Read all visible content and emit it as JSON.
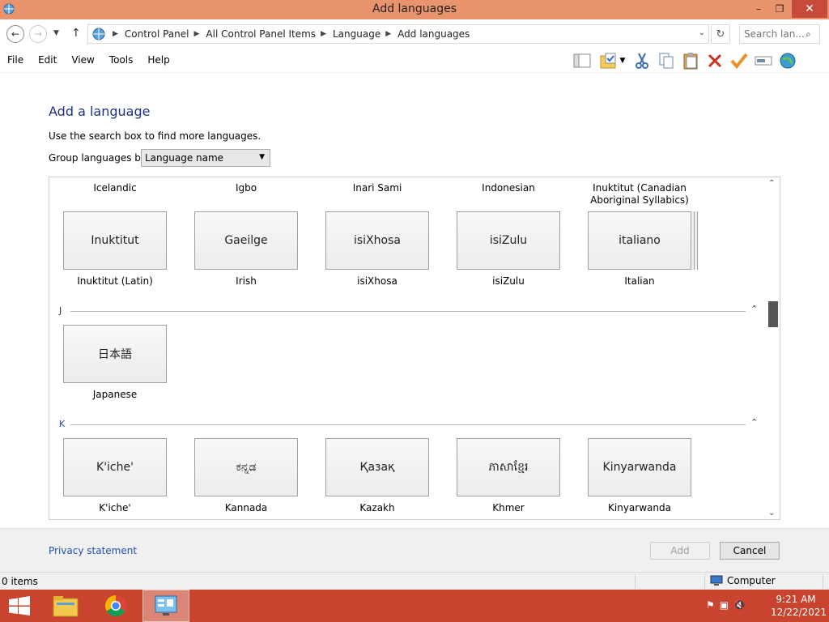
{
  "window": {
    "title": "Add languages",
    "minimize": "–",
    "maximize": "❐",
    "close": "✕"
  },
  "address": {
    "crumbs": [
      "Control Panel",
      "All Control Panel Items",
      "Language",
      "Add languages"
    ],
    "search_placeholder": "Search lan..."
  },
  "menu": [
    "File",
    "Edit",
    "View",
    "Tools",
    "Help"
  ],
  "toolbar_icons": [
    "layout-pane-icon",
    "folder-properties-icon",
    "cut-icon",
    "copy-icon",
    "paste-icon",
    "delete-icon",
    "check-icon",
    "rename-icon",
    "globe-icon"
  ],
  "page": {
    "heading": "Add a language",
    "help_text": "Use the search box to find more languages.",
    "group_label": "Group languages by:",
    "group_value": "Language name"
  },
  "top_labels": [
    "Icelandic",
    "Igbo",
    "Inari Sami",
    "Indonesian",
    "Inuktitut (Canadian Aboriginal Syllabics)"
  ],
  "i_tiles": [
    {
      "native": "Inuktitut",
      "name": "Inuktitut (Latin)"
    },
    {
      "native": "Gaeilge",
      "name": "Irish"
    },
    {
      "native": "isiXhosa",
      "name": "isiXhosa"
    },
    {
      "native": "isiZulu",
      "name": "isiZulu"
    },
    {
      "native": "italiano",
      "name": "Italian"
    }
  ],
  "groups": {
    "j": "J",
    "k": "K",
    "collapse": "⌃"
  },
  "j_tiles": [
    {
      "native": "日本語",
      "name": "Japanese"
    }
  ],
  "k_tiles": [
    {
      "native": "K'iche'",
      "name": "K'iche'"
    },
    {
      "native": "ಕನ್ನಡ",
      "name": "Kannada"
    },
    {
      "native": "Қазақ",
      "name": "Kazakh"
    },
    {
      "native": "ភាសាខ្មែរ",
      "name": "Khmer"
    },
    {
      "native": "Kinyarwanda",
      "name": "Kinyarwanda"
    }
  ],
  "footer": {
    "privacy": "Privacy statement",
    "add": "Add",
    "cancel": "Cancel"
  },
  "status": {
    "items": "0 items",
    "location": "Computer"
  },
  "taskbar": {
    "time": "9:21 AM",
    "date": "12/22/2021"
  },
  "colors": {
    "taskbar": "#c8442e",
    "titlebar": "#e9946c",
    "heading": "#1e3287",
    "link": "#1e50b4"
  }
}
